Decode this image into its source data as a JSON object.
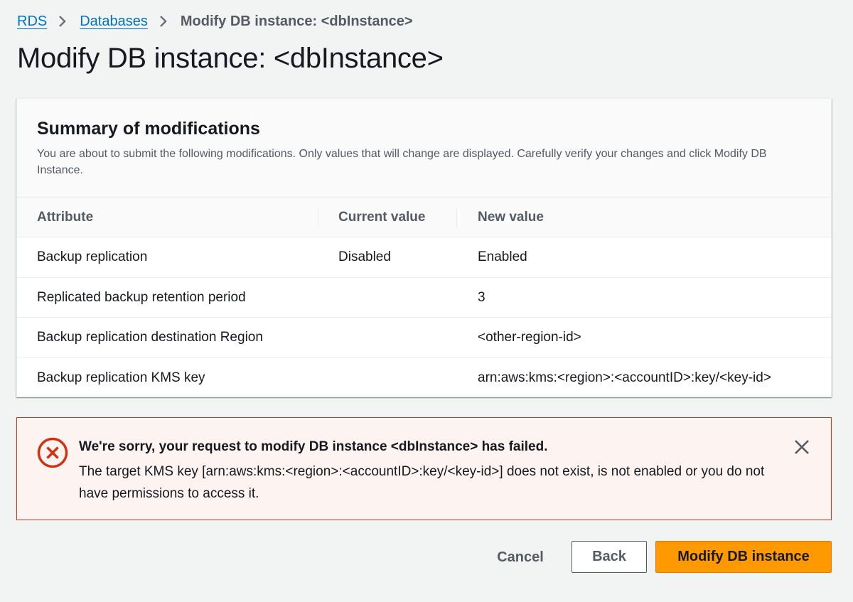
{
  "breadcrumb": {
    "items": [
      {
        "label": "RDS"
      },
      {
        "label": "Databases"
      },
      {
        "label": "Modify DB instance: <dbInstance>"
      }
    ]
  },
  "page": {
    "title": "Modify DB instance: <dbInstance>"
  },
  "summary": {
    "title": "Summary of modifications",
    "description": "You are about to submit the following modifications. Only values that will change are displayed. Carefully verify your changes and click Modify DB Instance.",
    "columns": [
      "Attribute",
      "Current value",
      "New value"
    ],
    "rows": [
      {
        "attribute": "Backup replication",
        "current": "Disabled",
        "new": "Enabled"
      },
      {
        "attribute": "Replicated backup retention period",
        "current": "",
        "new": "3"
      },
      {
        "attribute": "Backup replication destination Region",
        "current": "",
        "new": "<other-region-id>"
      },
      {
        "attribute": "Backup replication KMS key",
        "current": "",
        "new": "arn:aws:kms:<region>:<accountID>:key/<key-id>"
      }
    ]
  },
  "alert": {
    "type": "error",
    "icon": "error-circle-icon",
    "title": "We're sorry, your request to modify DB instance <dbInstance> has failed.",
    "message": "The target KMS key [arn:aws:kms:<region>:<accountID>:key/<key-id>] does not exist, is not enabled or you do not have permissions to access it.",
    "close_icon": "close-icon"
  },
  "actions": {
    "cancel_label": "Cancel",
    "back_label": "Back",
    "submit_label": "Modify DB instance"
  },
  "colors": {
    "link": "#0073bb",
    "error": "#d13212",
    "error_bg": "#fdf3f1",
    "primary": "#ff9900",
    "background": "#f2f3f3"
  }
}
